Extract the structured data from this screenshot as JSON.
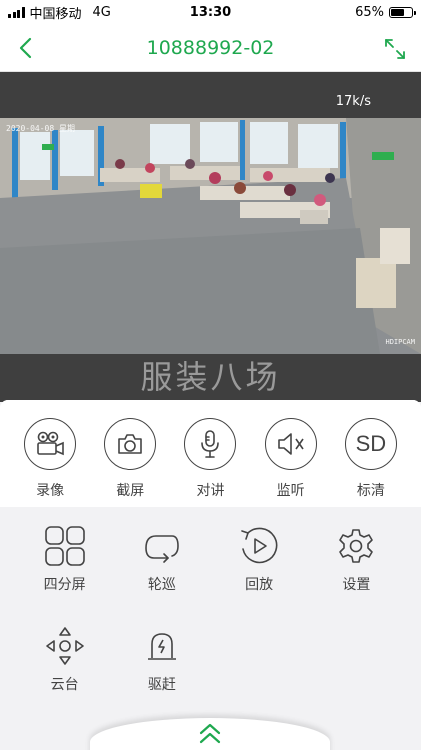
{
  "status_bar": {
    "carrier": "中国移动",
    "network": "4G",
    "time": "13:30",
    "battery_text": "65%",
    "battery_level": 0.65
  },
  "nav": {
    "title": "10888992-02",
    "back_icon": "chevron-left-icon",
    "fullscreen_icon": "expand-icon"
  },
  "video": {
    "speed": "17k/s",
    "timestamp": "2020-04-08 星期",
    "watermark": "HDIPCAM",
    "camera_name": "服装八场"
  },
  "controls": [
    {
      "label": "录像",
      "icon": "video-camera-icon"
    },
    {
      "label": "截屏",
      "icon": "camera-icon"
    },
    {
      "label": "对讲",
      "icon": "microphone-icon"
    },
    {
      "label": "监听",
      "icon": "speaker-mute-icon"
    },
    {
      "label": "标清",
      "icon": "sd-icon",
      "icon_text": "SD"
    }
  ],
  "functions": [
    {
      "label": "四分屏",
      "icon": "quad-screen-icon"
    },
    {
      "label": "轮巡",
      "icon": "loop-icon"
    },
    {
      "label": "回放",
      "icon": "playback-icon"
    },
    {
      "label": "设置",
      "icon": "gear-icon"
    },
    {
      "label": "云台",
      "icon": "ptz-direction-icon"
    },
    {
      "label": "驱赶",
      "icon": "alarm-light-icon"
    }
  ],
  "colors": {
    "accent": "#1fa84f",
    "video_bg": "#3f3f3f",
    "panel_bg": "#f2f2f4"
  },
  "bottom_handle_icon": "double-chevron-up-icon"
}
